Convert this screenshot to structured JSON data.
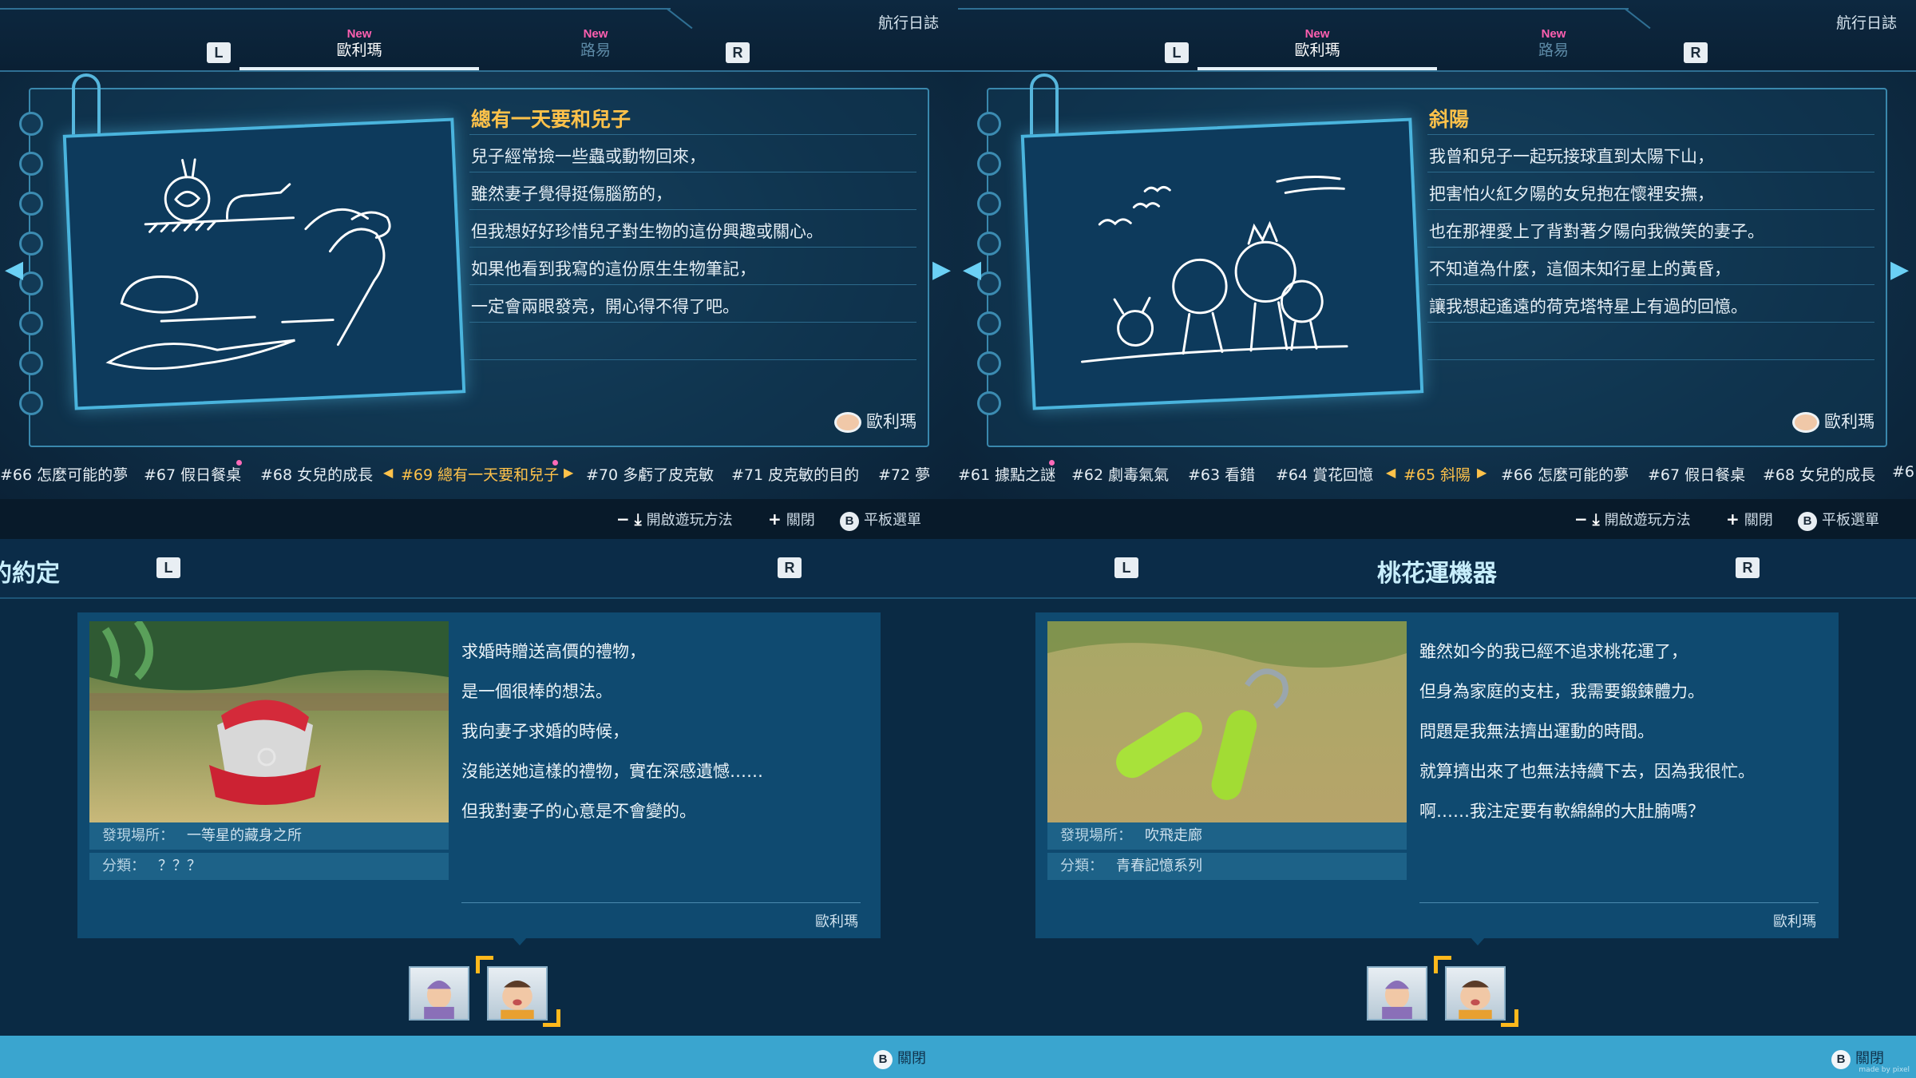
{
  "log_left": {
    "app_title": "航行日誌",
    "left_key": "L",
    "right_key": "R",
    "tabs": [
      {
        "new": "New",
        "label": "歐利瑪"
      },
      {
        "new": "New",
        "label": "路易"
      }
    ],
    "entry_title": "總有一天要和兒子",
    "lines": [
      "兒子經常撿一些蟲或動物回來，",
      "雖然妻子覺得挺傷腦筋的，",
      "但我想好好珍惜兒子對生物的這份興趣或關心。",
      "如果他看到我寫的這份原生生物筆記，",
      "一定會兩眼發亮，開心得不得了吧。"
    ],
    "author": "歐利瑪",
    "timeline": {
      "before": [
        "#66 怎麼可能的夢",
        "#67 假日餐桌",
        "#68 女兒的成長"
      ],
      "current": "#69 總有一天要和兒子",
      "after": [
        "#70 多虧了皮克敏",
        "#71 皮克敏的目的",
        "#72 夢"
      ]
    },
    "hints": {
      "open": "開啟遊玩方法",
      "close": "關閉",
      "b_key": "B",
      "tablet": "平板選單"
    }
  },
  "log_right": {
    "app_title": "航行日誌",
    "left_key": "L",
    "right_key": "R",
    "tabs": [
      {
        "new": "New",
        "label": "歐利瑪"
      },
      {
        "new": "New",
        "label": "路易"
      }
    ],
    "entry_title": "斜陽",
    "lines": [
      "我曾和兒子一起玩接球直到太陽下山，",
      "把害怕火紅夕陽的女兒抱在懷裡安撫，",
      "也在那裡愛上了背對著夕陽向我微笑的妻子。",
      "不知道為什麼，這個未知行星上的黃昏，",
      "讓我想起遙遠的荷克塔特星上有過的回憶。"
    ],
    "author": "歐利瑪",
    "timeline": {
      "before": [
        "#61 據點之謎",
        "#62 劇毒氣氣",
        "#63 看錯",
        "#64 賞花回憶"
      ],
      "current": "#65 斜陽",
      "after": [
        "#66 怎麼可能的夢",
        "#67 假日餐桌",
        "#68 女兒的成長",
        "#6"
      ]
    },
    "hints": {
      "open": "開啟遊玩方法",
      "close": "關閉",
      "b_key": "B",
      "tablet": "平板選單"
    }
  },
  "treasure_left": {
    "title": "堅硬的約定",
    "left_key": "L",
    "right_key": "R",
    "desc": [
      "求婚時贈送高價的禮物，",
      "是一個很棒的想法。",
      "我向妻子求婚的時候，",
      "沒能送她這樣的禮物，實在深感遺憾……",
      "但我對妻子的心意是不會變的。"
    ],
    "location_label": "發現場所：",
    "location": "一等星的藏身之所",
    "category_label": "分類：",
    "category": "？？？",
    "author": "歐利瑪",
    "close": "關閉",
    "b_key": "B"
  },
  "treasure_right": {
    "title": "桃花運機器",
    "left_key": "L",
    "right_key": "R",
    "desc": [
      "雖然如今的我已經不追求桃花運了，",
      "但身為家庭的支柱，我需要鍛鍊體力。",
      "問題是我無法擠出運動的時間。",
      "就算擠出來了也無法持續下去，因為我很忙。",
      "啊……我注定要有軟綿綿的大肚腩嗎？"
    ],
    "location_label": "發現場所：",
    "location": "吹飛走廊",
    "category_label": "分類：",
    "category": "青春記憶系列",
    "author": "歐利瑪",
    "close": "關閉",
    "b_key": "B",
    "watermark": "made by pixel"
  },
  "colors": {
    "accent_gold": "#ffc24a",
    "new_pink": "#ff5fb0",
    "blueprint": "#4ab4dd",
    "bar_blue": "#3aa5cf"
  },
  "icons": [
    "chevron-left-icon",
    "chevron-right-icon",
    "minus-icon",
    "download-icon",
    "plus-icon",
    "b-button-icon",
    "olimar-face-icon",
    "paperclip-icon"
  ]
}
